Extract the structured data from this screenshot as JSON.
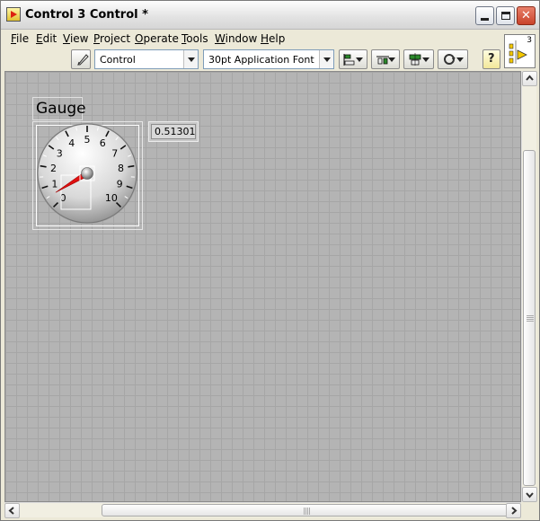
{
  "window": {
    "title": "Control 3 Control *"
  },
  "menu": [
    {
      "label": "File",
      "mnemonic": "F",
      "rest": "ile"
    },
    {
      "label": "Edit",
      "mnemonic": "E",
      "rest": "dit"
    },
    {
      "label": "View",
      "mnemonic": "V",
      "rest": "iew"
    },
    {
      "label": "Project",
      "mnemonic": "P",
      "rest": "roject"
    },
    {
      "label": "Operate",
      "mnemonic": "O",
      "rest": "perate"
    },
    {
      "label": "Tools",
      "mnemonic": "T",
      "rest": "ools"
    },
    {
      "label": "Window",
      "mnemonic": "W",
      "rest": "indow"
    },
    {
      "label": "Help",
      "mnemonic": "H",
      "rest": "elp"
    }
  ],
  "toolbar": {
    "control_type": "Control",
    "font": "30pt Application Font",
    "icons": [
      "edit-text-icon",
      "align-objects-icon",
      "distribute-objects-icon",
      "resize-objects-icon",
      "reorder-icon",
      "context-help-icon"
    ],
    "help_label": "?"
  },
  "connector": {
    "number": "3"
  },
  "gauge": {
    "label": "Gauge",
    "value": 0.51301,
    "digital_display": "0.51301",
    "scale": {
      "min": 0,
      "max": 10
    },
    "ticks": [
      "0",
      "1",
      "2",
      "3",
      "4",
      "5",
      "6",
      "7",
      "8",
      "9",
      "10"
    ],
    "needle_color": "#e01010"
  }
}
